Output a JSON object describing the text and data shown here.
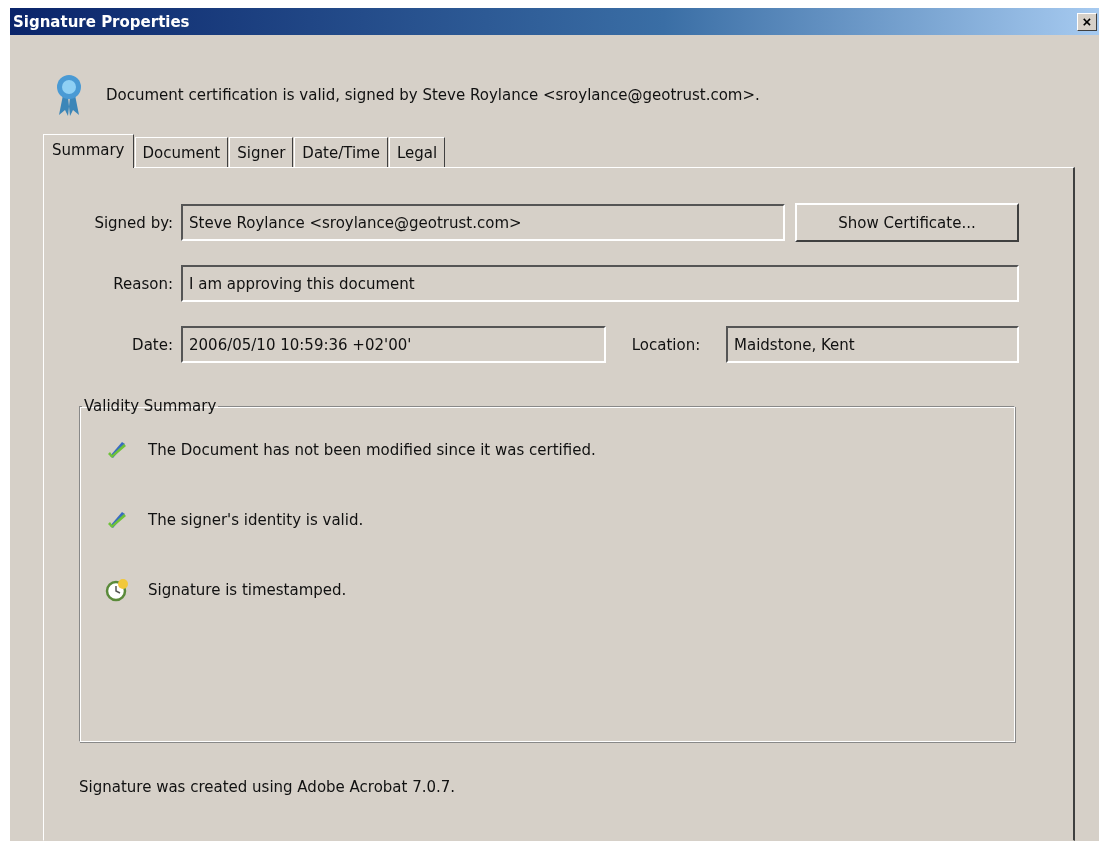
{
  "window": {
    "title": "Signature Properties",
    "close": "×"
  },
  "status_message": "Document certification is valid, signed by Steve Roylance <sroylance@geotrust.com>.",
  "tabs": [
    {
      "label": "Summary",
      "selected": true
    },
    {
      "label": "Document",
      "selected": false
    },
    {
      "label": "Signer",
      "selected": false
    },
    {
      "label": "Date/Time",
      "selected": false
    },
    {
      "label": "Legal",
      "selected": false
    }
  ],
  "summary": {
    "signed_by": {
      "label": "Signed by:",
      "value": "Steve Roylance <sroylance@geotrust.com>"
    },
    "show_certificate_button": "Show Certificate...",
    "reason": {
      "label": "Reason:",
      "value": "I am approving this document"
    },
    "date": {
      "label": "Date:",
      "value": "2006/05/10 10:59:36 +02'00'"
    },
    "location": {
      "label": "Location:",
      "value": "Maidstone, Kent"
    },
    "validity_summary": {
      "title": "Validity Summary",
      "items": [
        {
          "kind": "check",
          "text": "The Document has not been modified since it was certified."
        },
        {
          "kind": "check",
          "text": "The signer's identity is valid."
        },
        {
          "kind": "clock",
          "text": "Signature is timestamped."
        }
      ]
    },
    "footer": "Signature was created using Adobe Acrobat 7.0.7."
  }
}
